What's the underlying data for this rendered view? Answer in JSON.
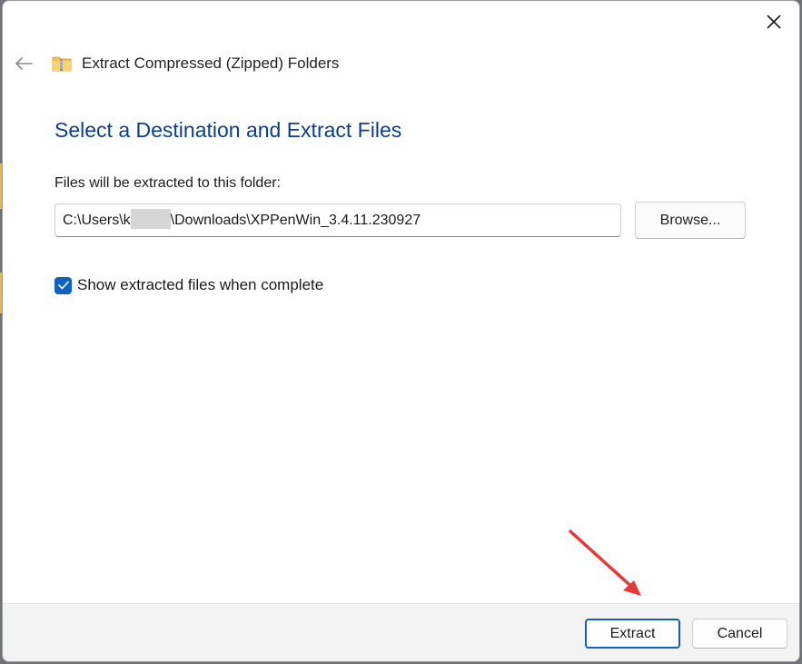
{
  "window": {
    "title": "Extract Compressed (Zipped) Folders",
    "close_icon": "close-icon",
    "back_icon": "back-arrow-icon",
    "app_icon": "zipped-folder-icon"
  },
  "main": {
    "heading": "Select a Destination and Extract Files",
    "destination_label": "Files will be extracted to this folder:",
    "path_prefix": "C:\\Users\\k",
    "path_suffix": "\\Downloads\\XPPenWin_3.4.11.230927",
    "browse_label": "Browse...",
    "show_files_checked": true,
    "show_files_label": "Show extracted files when complete"
  },
  "footer": {
    "extract_label": "Extract",
    "cancel_label": "Cancel"
  },
  "colors": {
    "accent": "#0f62c4",
    "heading": "#0d3d8c",
    "annotation_arrow": "#e53935"
  }
}
